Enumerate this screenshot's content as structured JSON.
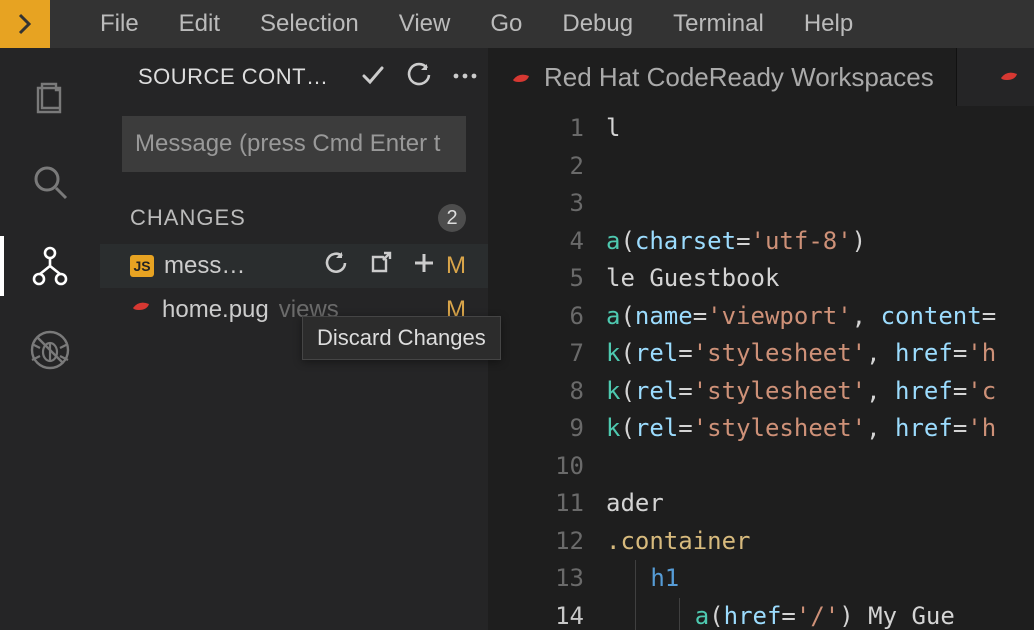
{
  "menu": {
    "items": [
      "File",
      "Edit",
      "Selection",
      "View",
      "Go",
      "Debug",
      "Terminal",
      "Help"
    ]
  },
  "sidebar": {
    "title": "SOURCE CONT…",
    "commit_placeholder": "Message (press Cmd Enter t",
    "changes_label": "CHANGES",
    "changes_count": "2",
    "files": [
      {
        "name": "mess…",
        "folder": "",
        "status": "M",
        "icon": "js"
      },
      {
        "name": "home.pug",
        "folder": "views",
        "status": "M",
        "icon": "pug"
      }
    ]
  },
  "tooltip": "Discard Changes",
  "tab": {
    "title": "Red Hat CodeReady Workspaces"
  },
  "editor": {
    "lines": [
      {
        "n": "1",
        "html": "<span class='t-plain'>l</span>"
      },
      {
        "n": "2",
        "html": ""
      },
      {
        "n": "3",
        "html": ""
      },
      {
        "n": "4",
        "html": "<span class='t-func'>a</span><span class='t-plain'>(</span><span class='t-attr'>charset</span><span class='t-plain'>=</span><span class='t-str'>'utf-8'</span><span class='t-plain'>)</span>"
      },
      {
        "n": "5",
        "html": "<span class='t-plain'>le Guestbook</span>"
      },
      {
        "n": "6",
        "html": "<span class='t-func'>a</span><span class='t-plain'>(</span><span class='t-attr'>name</span><span class='t-plain'>=</span><span class='t-str'>'viewport'</span><span class='t-plain'>, </span><span class='t-attr'>content</span><span class='t-plain'>=</span>"
      },
      {
        "n": "7",
        "html": "<span class='t-func'>k</span><span class='t-plain'>(</span><span class='t-attr'>rel</span><span class='t-plain'>=</span><span class='t-str'>'stylesheet'</span><span class='t-plain'>, </span><span class='t-attr'>href</span><span class='t-plain'>=</span><span class='t-str'>'h</span>"
      },
      {
        "n": "8",
        "html": "<span class='t-func'>k</span><span class='t-plain'>(</span><span class='t-attr'>rel</span><span class='t-plain'>=</span><span class='t-str'>'stylesheet'</span><span class='t-plain'>, </span><span class='t-attr'>href</span><span class='t-plain'>=</span><span class='t-str'>'c</span>"
      },
      {
        "n": "9",
        "html": "<span class='t-func'>k</span><span class='t-plain'>(</span><span class='t-attr'>rel</span><span class='t-plain'>=</span><span class='t-str'>'stylesheet'</span><span class='t-plain'>, </span><span class='t-attr'>href</span><span class='t-plain'>=</span><span class='t-str'>'h</span>"
      },
      {
        "n": "10",
        "html": ""
      },
      {
        "n": "11",
        "html": "<span class='t-plain'>ader</span>"
      },
      {
        "n": "12",
        "html": "<span class='t-class'>.container</span>"
      },
      {
        "n": "13",
        "html": "  <span class='indent-guide'></span> <span class='t-tag'>h1</span>"
      },
      {
        "n": "14",
        "html": "  <span class='indent-guide'></span>   <span class='indent-guide'></span> <span class='t-func'>a</span><span class='t-plain'>(</span><span class='t-attr'>href</span><span class='t-plain'>=</span><span class='t-str'>'/'</span><span class='t-plain'>) My Gue</span>",
        "active": true
      }
    ]
  }
}
